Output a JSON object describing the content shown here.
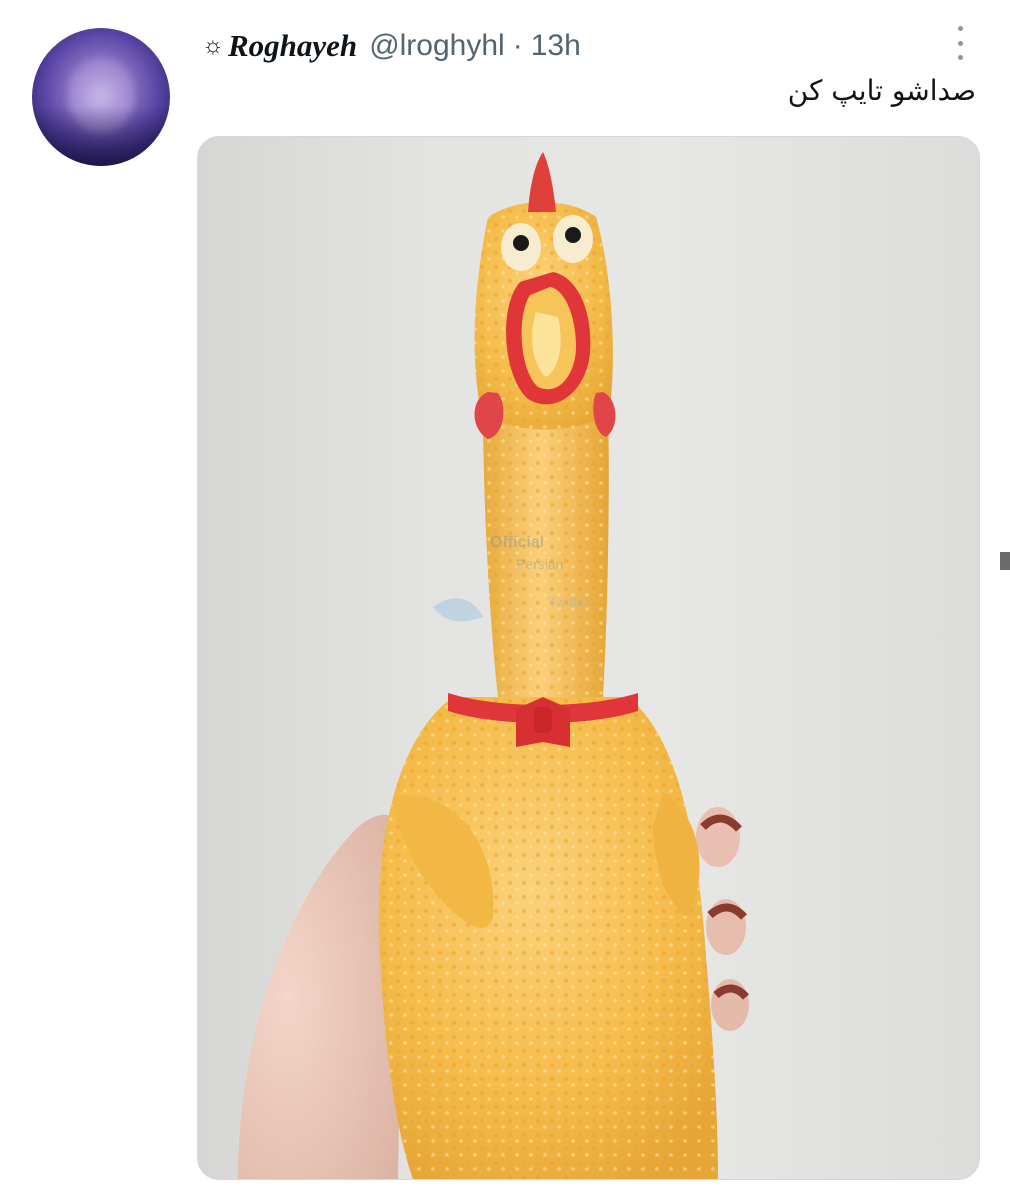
{
  "tweet": {
    "display_name": "Roghayeh",
    "name_prefix_glyph": "☼",
    "handle": "@lroghyhl",
    "separator": "·",
    "time": "13h",
    "text": "صداشو تایپ کن",
    "media": {
      "subject": "rubber-chicken-toy",
      "watermark": "Official Persian Twitter"
    }
  },
  "colors": {
    "text_primary": "#0f1419",
    "text_secondary": "#536471",
    "toy_body": "#f7c04a",
    "toy_accent": "#e33b3b",
    "background_wall": "#e3e3e1"
  },
  "icons": {
    "more": "more-dots-vertical-icon",
    "name_prefix": "sun-icon"
  }
}
